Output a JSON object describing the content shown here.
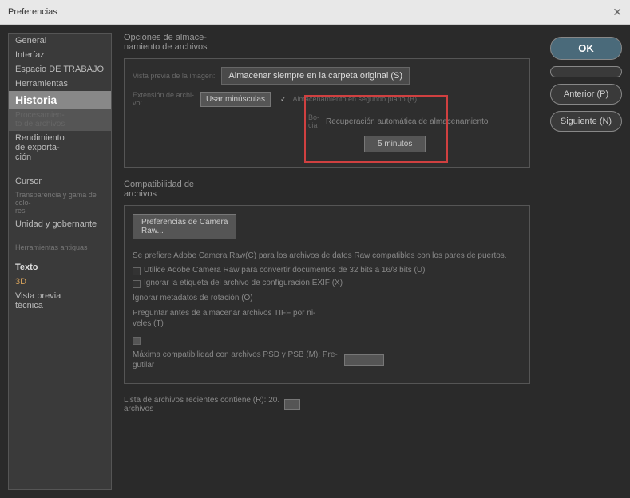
{
  "titlebar": {
    "title": "Preferencias"
  },
  "sidebar": {
    "items": [
      {
        "label": "General",
        "key": "general"
      },
      {
        "label": "Interfaz",
        "key": "interfaz"
      },
      {
        "label": "Espacio DE TRABAJO",
        "key": "workspace"
      },
      {
        "label": "Herramientas",
        "key": "tools"
      },
      {
        "label": "Historia",
        "key": "history",
        "selected": true
      },
      {
        "label": "Procesamien-\nto de archivos",
        "key": "fileproc",
        "dim": true
      },
      {
        "label": "Rendimiento\nde exporta-\nción",
        "key": "export"
      },
      {
        "label": "Cursor",
        "key": "cursor"
      },
      {
        "label": "Transparencia y gama de colo-\nres",
        "key": "transp",
        "small": true
      },
      {
        "label": "Unidad y gobernante",
        "key": "units"
      },
      {
        "label": "Herramientas antiguas",
        "key": "legacy",
        "small": true
      },
      {
        "label": "Texto",
        "key": "text",
        "bold": true
      },
      {
        "label": "3D",
        "key": "3d"
      },
      {
        "label": "Vista previa\ntécnica",
        "key": "techprev"
      }
    ]
  },
  "content": {
    "section1_title": "Opciones de almace-\nnamiento de archivos",
    "preview_label": "Vista previa de la imagen:",
    "preview_value": "Almacenar siempre en la carpeta original (S)",
    "ext_label": "Extensión de archi-\nvo:",
    "ext_value": "Usar minúsculas",
    "bg_save": "Almacenamiento en segundo plano (B)",
    "auto_recovery": "Recuperación automática de almacenamiento",
    "bocia": "Bo-\ncia",
    "interval": "5 minutos",
    "section2_title": "Compatibilidad de\narchivos",
    "cameraraw_btn": "Preferencias de Camera\nRaw...",
    "prefer_acr": "Se prefiere Adobe Camera Raw(C) para los archivos de datos Raw compatibles con los pares de puertos.",
    "use_acr_32": "Utilice Adobe Camera Raw para convertir documentos de 32 bits a 16/8 bits (U)",
    "ignore_exif": "Ignorar la etiqueta del archivo de configuración EXIF (X)",
    "ignore_rotation": "Ignorar metadatos de rotación (O)",
    "ask_tiff": "Preguntar antes de almacenar archivos TIFF por ni-\nveles (T)",
    "psd_compat": "Máxima compatibilidad con archivos PSD y PSB (M): Pre-\ngutilar",
    "recent_files": "Lista de archivos recientes contiene (R): 20.\narchivos"
  },
  "buttons": {
    "ok": "OK",
    "cancel": "",
    "prev": "Anterior (P)",
    "next": "Siguiente (N)"
  }
}
